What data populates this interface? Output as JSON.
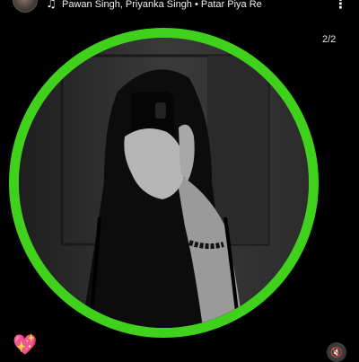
{
  "header": {
    "song_text": "Pawan Singh, Priyanka Singh • Patar Piya Re",
    "music_icon": "♫",
    "more_icon": "⋮"
  },
  "post": {
    "counter": "2/2",
    "ring_color": "#3fd11c"
  },
  "footer": {
    "heart_icon": "💖",
    "mute_icon": "🔇"
  }
}
